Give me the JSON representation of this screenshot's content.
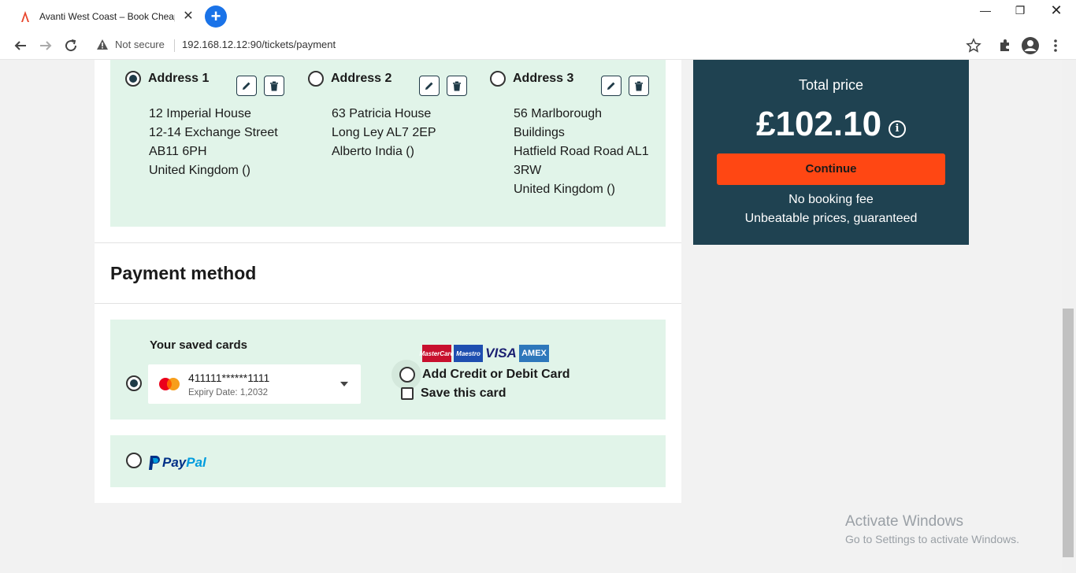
{
  "browser": {
    "tab_title": "Avanti West Coast – Book Cheap",
    "tab_close": "✕",
    "new_tab": "+",
    "security_label": "Not secure",
    "url": "192.168.12.12:90/tickets/payment"
  },
  "addresses": [
    {
      "title": "Address 1",
      "selected": true,
      "lines": [
        "12 Imperial House",
        "12-14 Exchange Street",
        "AB11 6PH",
        "United Kingdom ()"
      ]
    },
    {
      "title": "Address 2",
      "selected": false,
      "lines": [
        "63 Patricia House",
        "Long Ley AL7 2EP",
        "Alberto India ()"
      ]
    },
    {
      "title": "Address 3",
      "selected": false,
      "lines": [
        "56 Marlborough",
        "Buildings",
        "Hatfield Road Road AL1",
        "3RW",
        "United Kingdom ()"
      ]
    }
  ],
  "payment": {
    "section_title": "Payment method",
    "saved_cards_label": "Your saved cards",
    "saved_card": {
      "number": "411111******1111",
      "expiry": "Expiry Date: 1,2032"
    },
    "brands": [
      "MasterCard",
      "Maestro",
      "VISA",
      "AMEX"
    ],
    "add_card_label": "Add Credit or Debit Card",
    "save_card_label": "Save this card",
    "paypal": {
      "part1": "Pay",
      "part2": "Pal"
    }
  },
  "summary": {
    "total_label": "Total price",
    "total_value": "£102.10",
    "info": "i",
    "continue_label": "Continue",
    "note_1": "No booking fee",
    "note_2": "Unbeatable prices, guaranteed"
  },
  "watermark": {
    "line1": "Activate Windows",
    "line2": "Go to Settings to activate Windows."
  },
  "colors": {
    "panel_green": "#e1f4e9",
    "summary_bg": "#1f4251",
    "continue_bg": "#ff4713"
  }
}
